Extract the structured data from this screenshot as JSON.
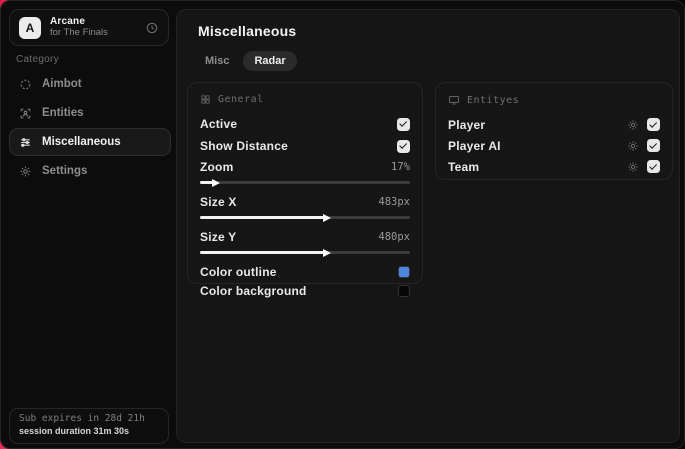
{
  "sidebar": {
    "app": {
      "avatar_letter": "A",
      "name": "Arcane",
      "subtitle": "for The Finals"
    },
    "category_label": "Category",
    "items": [
      {
        "label": "Aimbot",
        "active": false
      },
      {
        "label": "Entities",
        "active": false
      },
      {
        "label": "Miscellaneous",
        "active": true
      },
      {
        "label": "Settings",
        "active": false
      }
    ],
    "subscription": {
      "line1": "Sub expires in 28d 21h",
      "line2": "session duration 31m 30s"
    }
  },
  "main": {
    "title": "Miscellaneous",
    "tabs": [
      {
        "label": "Misc",
        "active": false
      },
      {
        "label": "Radar",
        "active": true
      }
    ],
    "general_panel": {
      "header": "General",
      "toggles": [
        {
          "label": "Active",
          "checked": true
        },
        {
          "label": "Show Distance",
          "checked": true
        }
      ],
      "sliders": [
        {
          "label": "Zoom",
          "display": "17%",
          "fill_percent": 7
        },
        {
          "label": "Size X",
          "display": "483px",
          "fill_percent": 60
        },
        {
          "label": "Size Y",
          "display": "480px",
          "fill_percent": 60
        }
      ],
      "colors": [
        {
          "label": "Color outline",
          "swatch": "#4d86e0"
        },
        {
          "label": "Color background",
          "swatch": "#060606"
        }
      ]
    },
    "entities_panel": {
      "header": "Entityes",
      "rows": [
        {
          "label": "Player",
          "checked": true
        },
        {
          "label": "Player AI",
          "checked": true
        },
        {
          "label": "Team",
          "checked": true
        }
      ]
    }
  },
  "colors": {
    "accent_red": "#e11d48",
    "outline_blue": "#4d86e0"
  }
}
